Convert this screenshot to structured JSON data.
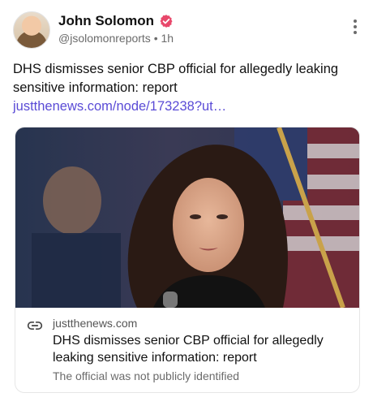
{
  "author": {
    "name": "John Solomon",
    "handle": "@jsolomonreports",
    "separator": "•",
    "time": "1h",
    "verified_icon": "verified-badge-icon",
    "verified_color": "#e8486b"
  },
  "post": {
    "text": "DHS dismisses senior CBP official for allegedly leaking sensitive information: report ",
    "link_text": "justthenews.com/node/173238?ut…",
    "link_color": "#5a4bd6"
  },
  "card": {
    "domain": "justthenews.com",
    "title": "DHS dismisses senior CBP official for allegedly leaking sensitive information: report",
    "description": "The official was not publicly identified",
    "link_icon": "link-icon"
  },
  "menu": {
    "icon": "more-vertical-icon"
  }
}
